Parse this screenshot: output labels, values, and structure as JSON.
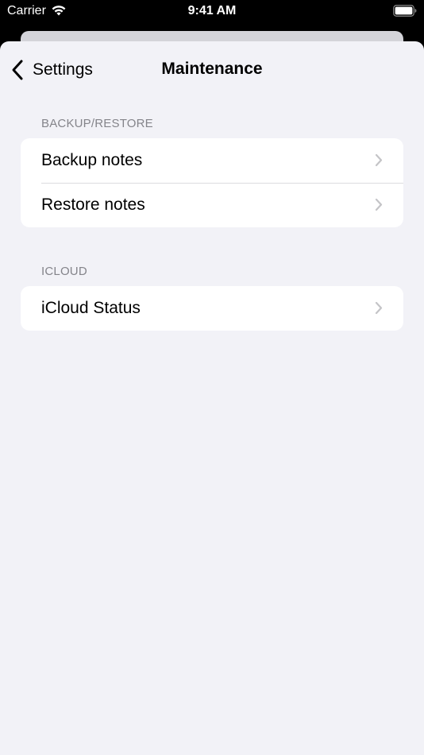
{
  "status_bar": {
    "carrier": "Carrier",
    "time": "9:41 AM",
    "icons": [
      "wifi-icon",
      "battery-icon"
    ]
  },
  "nav": {
    "back_label": "Settings",
    "back_icon": "chevron-left-icon",
    "title": "Maintenance"
  },
  "sections": [
    {
      "header": "BACKUP/RESTORE",
      "items": [
        {
          "label": "Backup notes",
          "icon": "chevron-right-icon"
        },
        {
          "label": "Restore notes",
          "icon": "chevron-right-icon"
        }
      ]
    },
    {
      "header": "ICLOUD",
      "items": [
        {
          "label": "iCloud Status",
          "icon": "chevron-right-icon"
        }
      ]
    }
  ],
  "colors": {
    "background": "#f2f2f7",
    "cell": "#ffffff",
    "section_header": "#84848a",
    "chevron": "#c4c4c7",
    "status_bar": "#000000"
  }
}
